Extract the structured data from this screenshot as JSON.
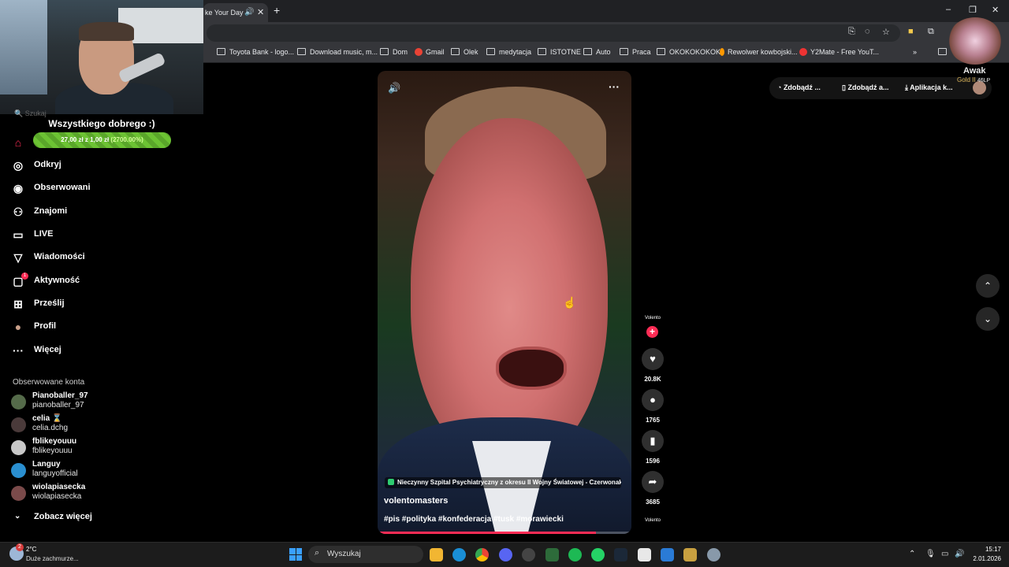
{
  "browser": {
    "tab_title": "ke Your Day",
    "bookmarks": [
      {
        "label": "Toyota Bank - logo..."
      },
      {
        "label": "Download music, m..."
      },
      {
        "label": "Dom"
      },
      {
        "label": "Gmail"
      },
      {
        "label": "Olek"
      },
      {
        "label": "medytacja"
      },
      {
        "label": "ISTOTNE"
      },
      {
        "label": "Auto"
      },
      {
        "label": "Praca"
      },
      {
        "label": "OKOKOKOKOK"
      },
      {
        "label": "Rewolwer kowbojski..."
      },
      {
        "label": "Y2Mate - Free YouT..."
      }
    ],
    "more_bookmarks": "»"
  },
  "sidebar": {
    "search_placeholder": "Szukaj",
    "banner_title": "Wszystkiego dobrego :)",
    "goal_text": "27,00 zł z 1,00 zł",
    "goal_pct": "(2700.00%)",
    "nav": [
      {
        "label": ""
      },
      {
        "label": "Odkryj"
      },
      {
        "label": "Obserwowani"
      },
      {
        "label": "Znajomi"
      },
      {
        "label": "LIVE"
      },
      {
        "label": "Wiadomości"
      },
      {
        "label": "Aktywność"
      },
      {
        "label": "Prześlij"
      },
      {
        "label": "Profil"
      },
      {
        "label": "Więcej"
      }
    ],
    "activity_badge": "1",
    "followed_title": "Obserwowane konta",
    "accounts": [
      {
        "name": "Pianoballer_97",
        "user": "pianoballer_97"
      },
      {
        "name": "celia ⌛",
        "user": "celia.dchg"
      },
      {
        "name": "fblikeyouuu",
        "user": "fblikeyouuu"
      },
      {
        "name": "Languy",
        "user": "languyofficial"
      },
      {
        "name": "wiolapiasecka",
        "user": "wiolapiasecka"
      }
    ],
    "see_more": "Zobacz więcej"
  },
  "video": {
    "location": "Nieczynny Szpital Psychiatryczny z okresu II Wojny Światowej - Czerwonak",
    "author": "volentomasters",
    "hashtags": "#pis #polityka #konfederacja #tusk #morawiecki",
    "progress": 0.86
  },
  "actions": {
    "creator_label": "Volento",
    "likes": "20.8K",
    "comments": "1765",
    "saves": "1596",
    "shares": "3685",
    "next_creator_label": "Volento"
  },
  "top_right": {
    "pill1": "Zdobądź ...",
    "pill2": "Zdobądź a...",
    "pill3": "Aplikacja k..."
  },
  "overlay": {
    "lol_name": "Awak",
    "lol_rank": "Gold II",
    "lol_lp": "46LP"
  },
  "taskbar": {
    "weather_temp": "2°C",
    "weather_desc": "Duże zachmurze...",
    "weather_badge": "2",
    "search_label": "Wyszukaj",
    "time": "15:17",
    "date": "2.01.2026"
  },
  "colors": {
    "accent": "#fe2c55",
    "goal_green": "#6cc233"
  }
}
